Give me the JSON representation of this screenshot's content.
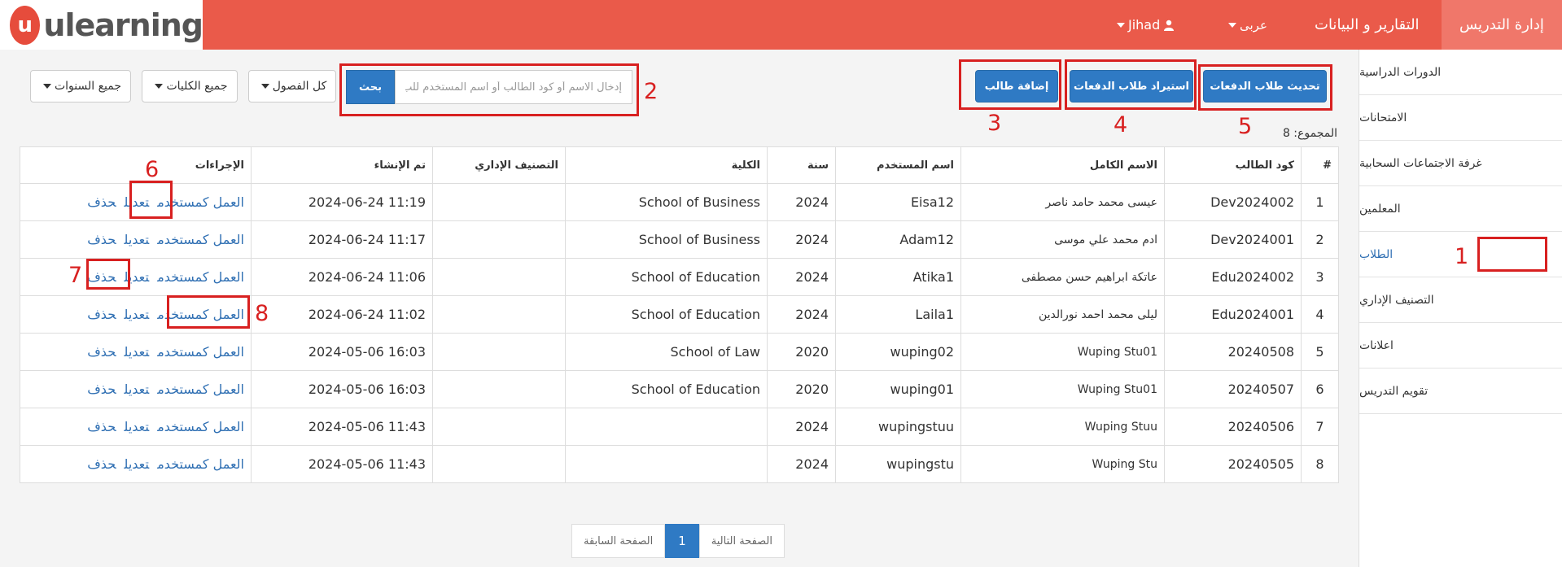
{
  "header": {
    "logo_text": "ulearning",
    "logo_mark": "u",
    "nav": {
      "teaching_admin": "إدارة التدريس",
      "reports": "التقارير و البيانات",
      "language": "عربى",
      "user": "Jihad"
    }
  },
  "sidebar": {
    "items": [
      {
        "label": "الدورات الدراسية"
      },
      {
        "label": "الامتحانات"
      },
      {
        "label": "غرفة الاجتماعات السحابية"
      },
      {
        "label": "المعلمين"
      },
      {
        "label": "الطلاب"
      },
      {
        "label": "التصنيف الإداري"
      },
      {
        "label": "اعلانات"
      },
      {
        "label": "تقويم التدريس"
      }
    ]
  },
  "toolbar": {
    "update_payment_students": "تحديث طلاب الدفعات",
    "import_payment_students": "استيراد طلاب الدفعات",
    "add_student": "إضافة طالب",
    "search_placeholder": "إدخال الاسم أو كود الطالب أو اسم المستخدم للب",
    "search_button": "بحث",
    "filter_semesters": "كل الفصول",
    "filter_colleges": "جميع الكليات",
    "filter_years": "جميع السنوات"
  },
  "total": "المجموع: 8",
  "table": {
    "headers": {
      "index": "#",
      "student_code": "كود الطالب",
      "full_name": "الاسم الكامل",
      "username": "اسم المستخدم",
      "year": "سنة",
      "college": "الكلية",
      "admin_class": "التصنيف الإداري",
      "created": "تم الإنشاء",
      "actions": "الإجراءات"
    },
    "action_labels": {
      "act_as_user": "العمل كمستخدم",
      "edit": "تعديل",
      "delete": "حذف"
    },
    "rows": [
      {
        "index": "1",
        "code": "Dev2024002",
        "name": "عيسى محمد حامد ناصر",
        "username": "Eisa12",
        "year": "2024",
        "college": "School of Business",
        "admin": "",
        "created": "2024-06-24 11:19"
      },
      {
        "index": "2",
        "code": "Dev2024001",
        "name": "ادم محمد علي موسى",
        "username": "Adam12",
        "year": "2024",
        "college": "School of Business",
        "admin": "",
        "created": "2024-06-24 11:17"
      },
      {
        "index": "3",
        "code": "Edu2024002",
        "name": "عاتكة ابراهيم حسن مصطفى",
        "username": "Atika1",
        "year": "2024",
        "college": "School of Education",
        "admin": "",
        "created": "2024-06-24 11:06"
      },
      {
        "index": "4",
        "code": "Edu2024001",
        "name": "ليلى محمد احمد نورالدين",
        "username": "Laila1",
        "year": "2024",
        "college": "School of Education",
        "admin": "",
        "created": "2024-06-24 11:02"
      },
      {
        "index": "5",
        "code": "20240508",
        "name": "Wuping Stu01",
        "username": "wuping02",
        "year": "2020",
        "college": "School of Law",
        "admin": "",
        "created": "2024-05-06 16:03"
      },
      {
        "index": "6",
        "code": "20240507",
        "name": "Wuping Stu01",
        "username": "wuping01",
        "year": "2020",
        "college": "School of Education",
        "admin": "",
        "created": "2024-05-06 16:03"
      },
      {
        "index": "7",
        "code": "20240506",
        "name": "Wuping Stuu",
        "username": "wupingstuu",
        "year": "2024",
        "college": "",
        "admin": "",
        "created": "2024-05-06 11:43"
      },
      {
        "index": "8",
        "code": "20240505",
        "name": "Wuping Stu",
        "username": "wupingstu",
        "year": "2024",
        "college": "",
        "admin": "",
        "created": "2024-05-06 11:43"
      }
    ]
  },
  "pagination": {
    "next": "الصفحة التالية",
    "current": "1",
    "prev": "الصفحة السابقة"
  },
  "annotations": {
    "n1": "1",
    "n2": "2",
    "n3": "3",
    "n4": "4",
    "n5": "5",
    "n6": "6",
    "n7": "7",
    "n8": "8"
  },
  "colors": {
    "header_bg": "#ea5a4a",
    "primary": "#2f7ac4",
    "link": "#2f6fb3",
    "annotation": "#d82020"
  }
}
